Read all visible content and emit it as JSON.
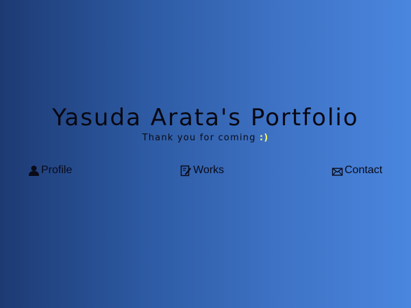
{
  "hero": {
    "title": "Yasuda Arata's Portfolio",
    "tagline": "Thank you for coming",
    "smiley": ":)"
  },
  "nav": {
    "items": [
      {
        "label": "Profile",
        "icon": "user-icon"
      },
      {
        "label": "Works",
        "icon": "edit-icon"
      },
      {
        "label": "Contact",
        "icon": "envelope-icon"
      }
    ]
  },
  "colors": {
    "background_start": "#1d3a73",
    "background_end": "#4a86de",
    "text": "#0a0a14",
    "smiley": "#f2f26a"
  }
}
